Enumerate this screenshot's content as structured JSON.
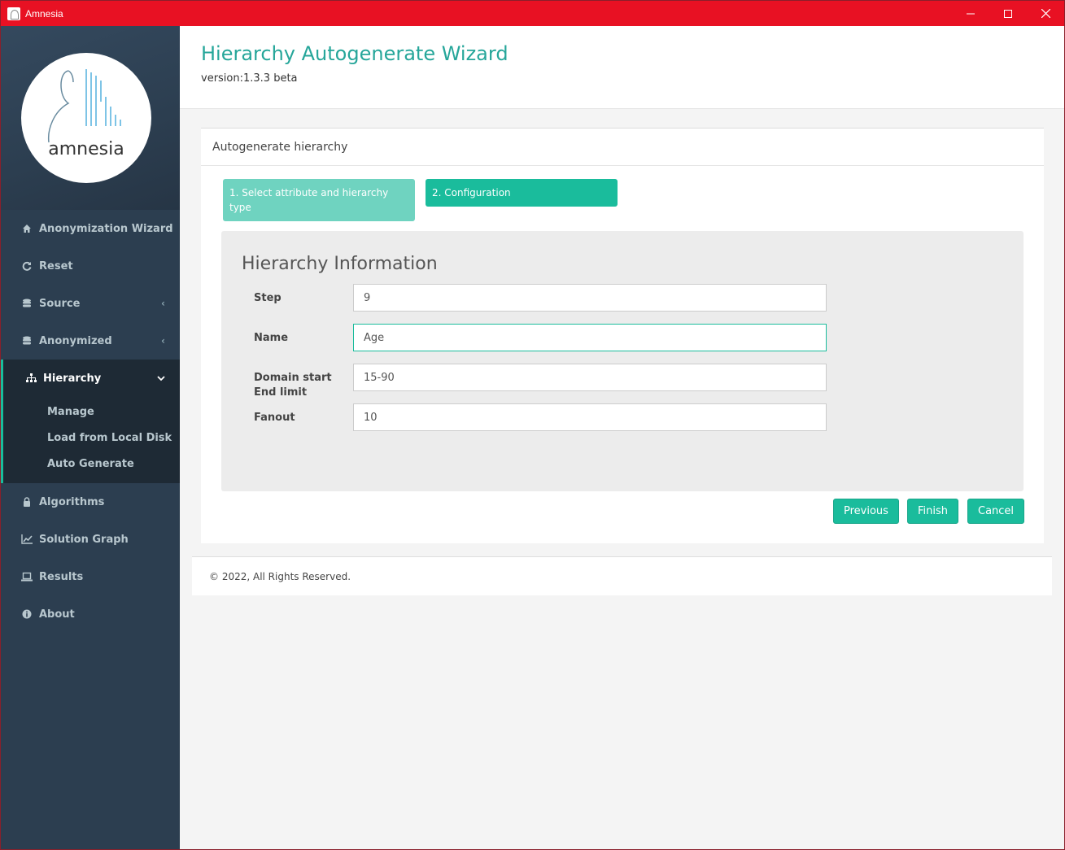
{
  "window": {
    "title": "Amnesia",
    "controls": {
      "minimize": "—",
      "maximize": "☐",
      "close": "✕"
    }
  },
  "logo": {
    "text": "amnesia"
  },
  "sidebar": {
    "items": [
      {
        "label": "Anonymization Wizard",
        "icon": "home-icon"
      },
      {
        "label": "Reset",
        "icon": "refresh-icon"
      },
      {
        "label": "Source",
        "icon": "database-icon"
      },
      {
        "label": "Anonymized",
        "icon": "database-icon"
      },
      {
        "label": "Hierarchy",
        "icon": "sitemap-icon"
      },
      {
        "label": "Algorithms",
        "icon": "lock-icon"
      },
      {
        "label": "Solution Graph",
        "icon": "line-chart-icon"
      },
      {
        "label": "Results",
        "icon": "laptop-icon"
      },
      {
        "label": "About",
        "icon": "info-icon"
      }
    ],
    "hierarchy_sub": [
      "Manage",
      "Load from Local Disk",
      "Auto Generate"
    ]
  },
  "header": {
    "title": "Hierarchy Autogenerate Wizard",
    "version": "version:1.3.3 beta"
  },
  "panel": {
    "title": "Autogenerate hierarchy",
    "steps": [
      "1. Select attribute and hierarchy type",
      "2. Configuration"
    ]
  },
  "form": {
    "title": "Hierarchy Information",
    "step_label": "Step",
    "step_value": "9",
    "name_label": "Name",
    "name_value": "Age",
    "domain_label_1": "Domain start",
    "domain_label_2": "End limit",
    "domain_value": "15-90",
    "fanout_label": "Fanout",
    "fanout_value": "10"
  },
  "buttons": {
    "previous": "Previous",
    "finish": "Finish",
    "cancel": "Cancel"
  },
  "footer": {
    "text": "© 2022, All Rights Reserved."
  },
  "colors": {
    "accent": "#1abc9c",
    "titlebar": "#e81123",
    "sidebar": "#2c3e50"
  }
}
